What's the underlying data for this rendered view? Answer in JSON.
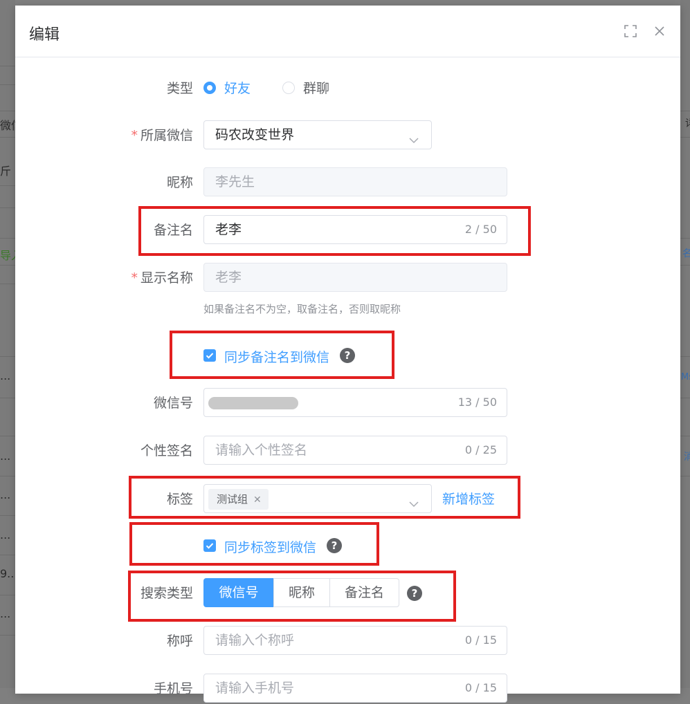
{
  "dialog": {
    "title": "编辑",
    "fields": {
      "type": {
        "label": "类型",
        "options": [
          {
            "label": "好友",
            "selected": true
          },
          {
            "label": "群聊",
            "selected": false
          }
        ]
      },
      "wechat": {
        "label": "所属微信",
        "value": "码农改变世界",
        "required": true
      },
      "nickname": {
        "label": "昵称",
        "placeholder": "李先生"
      },
      "remark": {
        "label": "备注名",
        "value": "老李",
        "counter": "2 / 50"
      },
      "display_name": {
        "label": "显示名称",
        "placeholder": "老李",
        "required": true,
        "hint": "如果备注名不为空，取备注名，否则取昵称"
      },
      "sync_remark": {
        "label": "同步备注名到微信",
        "checked": true
      },
      "wechat_id": {
        "label": "微信号",
        "counter": "13 / 50"
      },
      "signature": {
        "label": "个性签名",
        "placeholder": "请输入个性签名",
        "counter": "0 / 25"
      },
      "tags": {
        "label": "标签",
        "tag": "测试组",
        "add_link": "新增标签"
      },
      "sync_tags": {
        "label": "同步标签到微信",
        "checked": true
      },
      "search_type": {
        "label": "搜索类型",
        "options": [
          {
            "label": "微信号",
            "active": true
          },
          {
            "label": "昵称",
            "active": false
          },
          {
            "label": "备注名",
            "active": false
          }
        ]
      },
      "salutation": {
        "label": "称呼",
        "placeholder": "请输入个称呼",
        "counter": "0 / 15"
      },
      "phone": {
        "label": "手机号",
        "placeholder": "请输入手机号",
        "counter": "0 / 15"
      }
    }
  },
  "background": {
    "fragments": [
      "微信",
      "斤",
      "导入",
      "...",
      "...",
      "...",
      "...",
      "9...",
      "...",
      "详",
      "名",
      "Ms",
      "消"
    ]
  },
  "colors": {
    "accent": "#409eff",
    "required": "#f56c6c",
    "annotation": "#e21f1f"
  }
}
